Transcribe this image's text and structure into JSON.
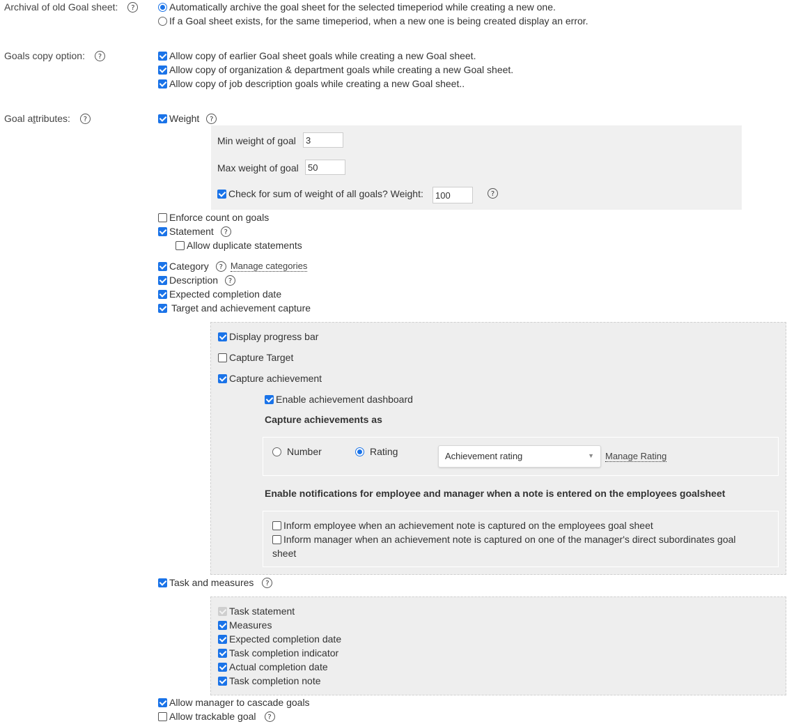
{
  "archival": {
    "label": "Archival of old Goal sheet:",
    "options": [
      {
        "label": "Automatically archive the goal sheet for the selected timeperiod while creating a new one.",
        "selected": true
      },
      {
        "label": "If a Goal sheet exists, for the same timeperiod, when a new one is being created display an error.",
        "selected": false
      }
    ]
  },
  "copy": {
    "label": "Goals copy option:",
    "options": [
      {
        "label": "Allow copy of earlier Goal sheet goals while creating a new Goal sheet.",
        "checked": true
      },
      {
        "label": "Allow copy of organization & department goals while creating a new Goal sheet.",
        "checked": true
      },
      {
        "label": "Allow copy of job description goals while creating a new Goal sheet..",
        "checked": true
      }
    ]
  },
  "attributes": {
    "label_pre": "Goal a",
    "label_u": "t",
    "label_post": "tributes:",
    "help": "?",
    "weight": {
      "label": "Weight",
      "checked": true,
      "min_label": "Min weight of goal",
      "min_value": "3",
      "max_label": "Max weight of goal",
      "max_value": "50",
      "sum_label": "Check for sum of weight of all goals? Weight:",
      "sum_checked": true,
      "sum_value": "100"
    },
    "enforce_count": {
      "label": "Enforce count on goals",
      "checked": false
    },
    "statement": {
      "label": "Statement",
      "checked": true
    },
    "allow_duplicate": {
      "label": "Allow duplicate statements",
      "checked": false
    },
    "category": {
      "label": "Category",
      "checked": true,
      "link": "Manage categories"
    },
    "description": {
      "label": "Description",
      "checked": true
    },
    "expected_completion": {
      "label": "Expected completion date",
      "checked": true
    },
    "target_achievement": {
      "label": "Target and achievement capture",
      "checked": true
    },
    "target_panel": {
      "display_progress": {
        "label": "Display progress bar",
        "checked": true
      },
      "capture_target": {
        "label": "Capture Target",
        "checked": false
      },
      "capture_achievement": {
        "label": "Capture achievement",
        "checked": true
      },
      "enable_dashboard": {
        "label": "Enable achievement dashboard",
        "checked": true
      },
      "capture_as_heading": "Capture achievements as",
      "capture_as": {
        "number_label": "Number",
        "number_selected": false,
        "rating_label": "Rating",
        "rating_selected": true,
        "select_value": "Achievement rating",
        "manage_link": "Manage Rating"
      },
      "notifications_heading": "Enable notifications for employee and manager when a note is entered on the employees goalsheet",
      "notify_employee": {
        "label": "Inform employee when an achievement note is captured on the employees goal sheet",
        "checked": false
      },
      "notify_manager": {
        "label_line1": "Inform manager when an achievement note is captured on one of the manager's direct subordinates goal",
        "label_line2": "sheet",
        "checked": false
      }
    },
    "task_measures": {
      "label": "Task and measures",
      "checked": true
    },
    "task_panel": [
      {
        "label": "Task statement",
        "checked": true,
        "disabled": true
      },
      {
        "label": "Measures",
        "checked": true,
        "disabled": false
      },
      {
        "label": "Expected completion date",
        "checked": true,
        "disabled": false
      },
      {
        "label": "Task completion indicator",
        "checked": true,
        "disabled": false
      },
      {
        "label": "Actual completion date",
        "checked": true,
        "disabled": false
      },
      {
        "label": "Task completion note",
        "checked": true,
        "disabled": false
      }
    ],
    "cascade": {
      "label": "Allow manager to cascade goals",
      "checked": true
    },
    "trackable": {
      "label": "Allow trackable goal",
      "checked": false
    }
  },
  "help_glyph": "?",
  "select_arrow": "▼",
  "colors": {
    "accent": "#1a73e8",
    "panel": "#f0f0f0",
    "panel_alt": "#eeeeee"
  }
}
